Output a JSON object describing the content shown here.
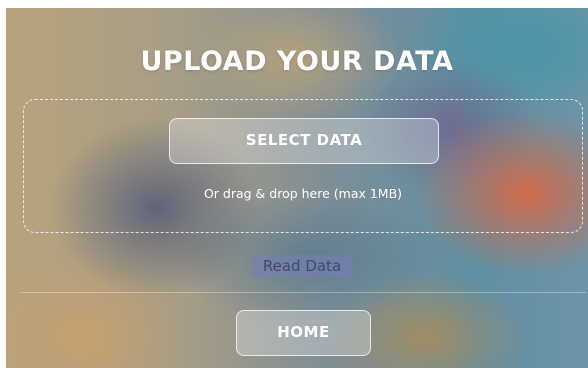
{
  "upload": {
    "title": "UPLOAD YOUR DATA",
    "select_label": "SELECT DATA",
    "hint": "Or drag & drop here (max 1MB)"
  },
  "actions": {
    "read_label": "Read Data",
    "home_label": "HOME"
  }
}
